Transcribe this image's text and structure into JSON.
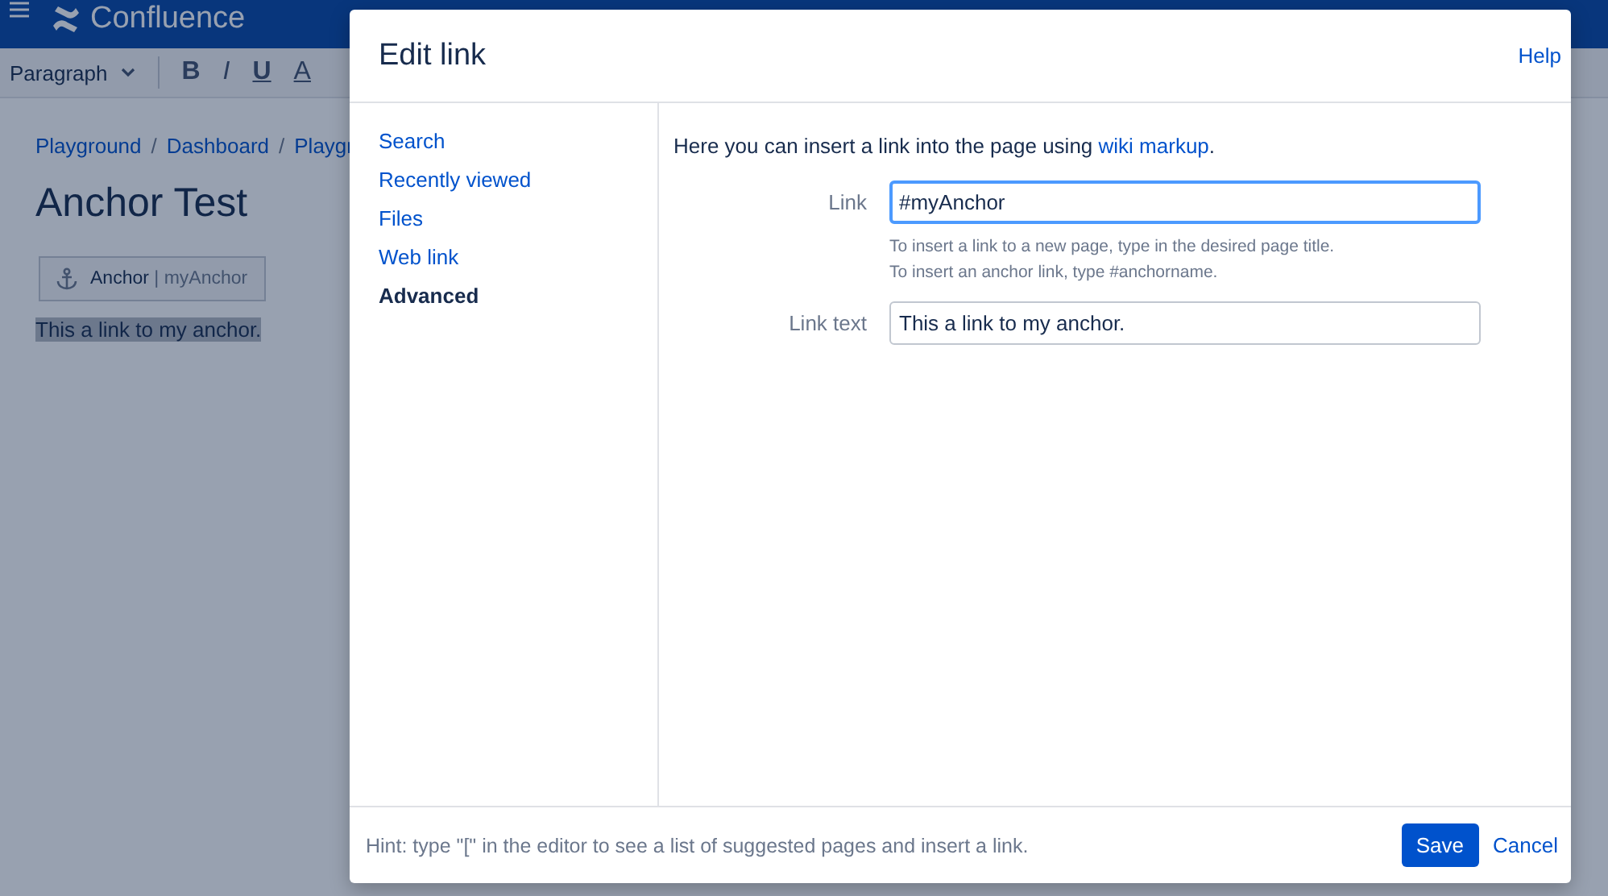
{
  "app_bar": {
    "logo": "Confluence"
  },
  "toolbar": {
    "style": "Paragraph",
    "formats": [
      "B",
      "I",
      "U",
      "A"
    ]
  },
  "breadcrumbs": {
    "separator": "/",
    "items": [
      "Playground",
      "Dashboard",
      "Playgr"
    ]
  },
  "page": {
    "title": "Anchor Test",
    "anchor_label": "Anchor",
    "anchor_separator": "|",
    "anchor_name": "myAnchor",
    "selected_text": "This a link to my anchor."
  },
  "dialog": {
    "title": "Edit link",
    "help": "Help",
    "tabs": [
      {
        "label": "Search",
        "selected": false
      },
      {
        "label": "Recently viewed",
        "selected": false
      },
      {
        "label": "Files",
        "selected": false
      },
      {
        "label": "Web link",
        "selected": false
      },
      {
        "label": "Advanced",
        "selected": true
      }
    ],
    "intro": {
      "before": "Here you can insert a link into the page using ",
      "link": "wiki markup",
      "after": "."
    },
    "fields": [
      {
        "label": "Link",
        "value": "#myAnchor",
        "focused": true,
        "hints": [
          "To insert a link to a new page, type in the desired page title.",
          "To insert an anchor link, type #anchorname."
        ]
      },
      {
        "label": "Link text",
        "value": "This a link to my anchor.",
        "focused": false
      }
    ],
    "footer_hint": "Hint: type \"[\" in the editor to see a list of suggested pages and insert a link.",
    "save": "Save",
    "cancel": "Cancel"
  }
}
